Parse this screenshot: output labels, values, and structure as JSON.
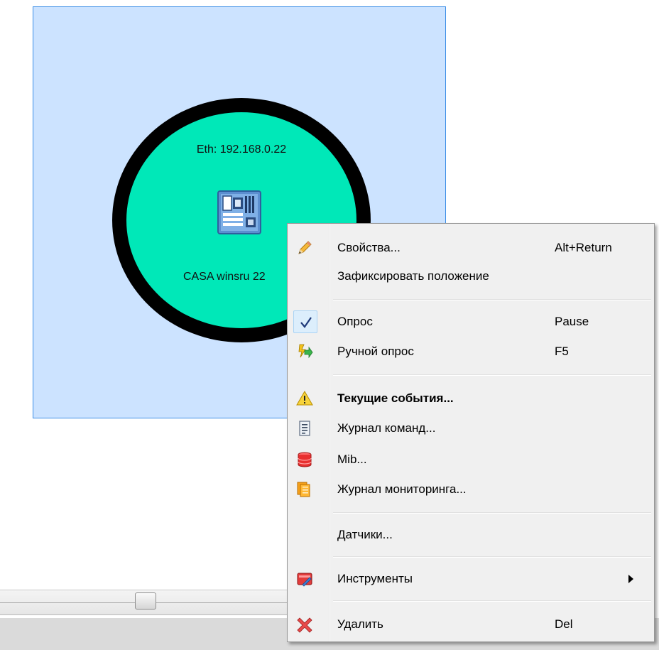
{
  "node": {
    "ip_label": "Eth: 192.168.0.22",
    "name_label": "CASA winsru 22",
    "device_icon": "motherboard-icon",
    "fill_color": "#00e8b8",
    "selection_color": "#cce3ff"
  },
  "context_menu": {
    "items": [
      {
        "label": "Свойства...",
        "shortcut": "Alt+Return",
        "icon": "pencil-icon"
      },
      {
        "label": "Зафиксировать положение",
        "shortcut": "",
        "icon": ""
      },
      {
        "label": "Опрос",
        "shortcut": "Pause",
        "icon": "checkmark-icon",
        "checked": true
      },
      {
        "label": "Ручной опрос",
        "shortcut": "F5",
        "icon": "manual-poll-icon"
      },
      {
        "label": "Текущие события...",
        "shortcut": "",
        "icon": "warning-icon",
        "bold": true
      },
      {
        "label": "Журнал команд...",
        "shortcut": "",
        "icon": "document-icon"
      },
      {
        "label": "Mib...",
        "shortcut": "",
        "icon": "database-icon"
      },
      {
        "label": "Журнал мониторинга...",
        "shortcut": "",
        "icon": "pages-icon"
      },
      {
        "label": "Датчики...",
        "shortcut": "",
        "icon": ""
      },
      {
        "label": "Инструменты",
        "shortcut": "",
        "icon": "tools-icon",
        "submenu": true
      },
      {
        "label": "Удалить",
        "shortcut": "Del",
        "icon": "delete-icon"
      }
    ]
  }
}
